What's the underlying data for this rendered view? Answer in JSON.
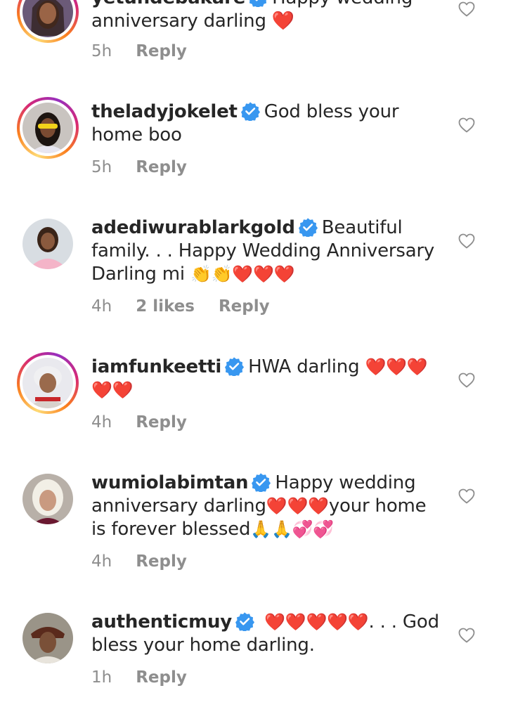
{
  "comments": [
    {
      "username": "yetundebakare",
      "text": "Happy wedding anniversary darling",
      "hearts": "❤️",
      "time": "5h",
      "likes": "",
      "reply": "Reply"
    },
    {
      "username": "theladyjokelet",
      "text": "God bless your home boo",
      "time": "5h",
      "likes": "",
      "reply": "Reply"
    },
    {
      "username": "adediwurablarkgold",
      "text": "Beautiful family. . . Happy Wedding Anniversary Darling mi",
      "emoji": "👏👏❤️❤️❤️",
      "time": "4h",
      "likes": "2 likes",
      "reply": "Reply"
    },
    {
      "username": "iamfunkeetti",
      "text": "HWA darling",
      "emoji": "❤️❤️❤️❤️❤️",
      "time": "4h",
      "likes": "",
      "reply": "Reply"
    },
    {
      "username": "wumiolabimtan",
      "text_a": "Happy wedding anniversary darling",
      "emoji_a": "❤️❤️❤️",
      "text_b": "your home is forever blessed",
      "emoji_b": "🙏🙏💞💞",
      "time": "4h",
      "likes": "",
      "reply": "Reply"
    },
    {
      "username": "authenticmuy",
      "emoji": "❤️❤️❤️❤️❤️",
      "text": ". . . God bless your home darling.",
      "time": "1h",
      "likes": "",
      "reply": "Reply"
    }
  ],
  "icons": {
    "verified": "verified-badge-icon",
    "like": "heart-outline-icon"
  },
  "colors": {
    "verified": "#3897f0",
    "heart": "#dd1c2a",
    "meta": "#8e8e8e",
    "text": "#262626"
  }
}
